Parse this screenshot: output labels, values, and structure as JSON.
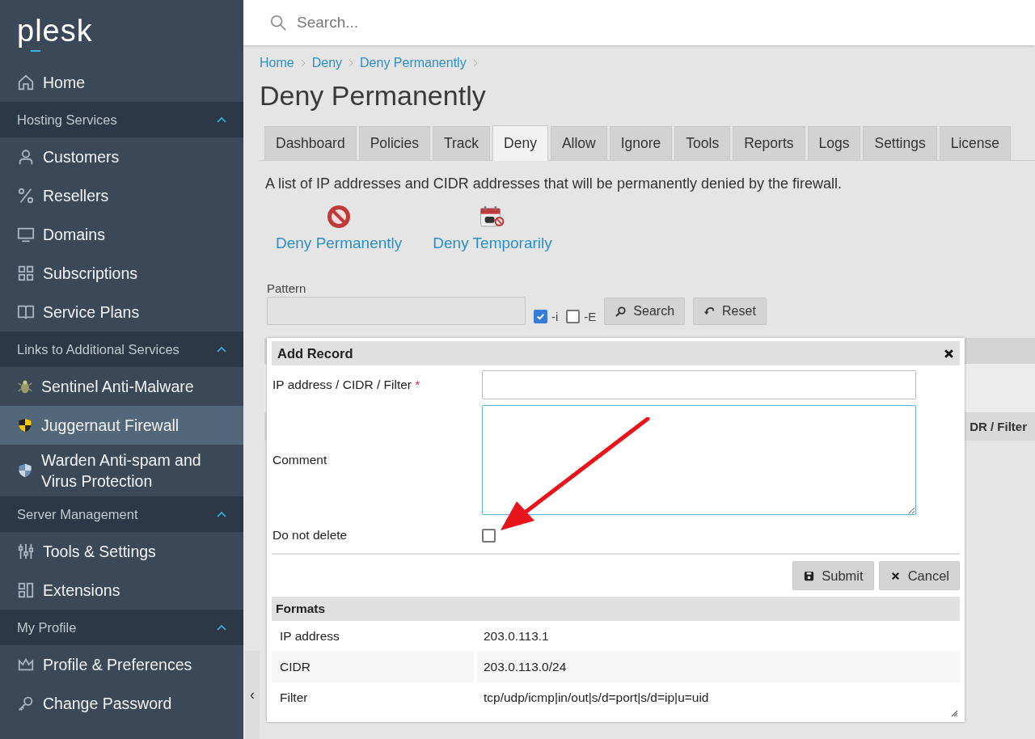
{
  "sidebar": {
    "logo": "plesk",
    "home": {
      "label": "Home",
      "selected": false
    },
    "sections": [
      {
        "title": "Hosting Services",
        "expanded": true,
        "items": [
          {
            "label": "Customers",
            "selected": false
          },
          {
            "label": "Resellers",
            "selected": false
          },
          {
            "label": "Domains",
            "selected": false
          },
          {
            "label": "Subscriptions",
            "selected": false
          },
          {
            "label": "Service Plans",
            "selected": false
          }
        ]
      },
      {
        "title": "Links to Additional Services",
        "expanded": true,
        "items": [
          {
            "label": "Sentinel Anti-Malware",
            "selected": false
          },
          {
            "label": "Juggernaut Firewall",
            "selected": true
          },
          {
            "label": "Warden Anti-spam and Virus Protection",
            "selected": false
          }
        ]
      },
      {
        "title": "Server Management",
        "expanded": true,
        "items": [
          {
            "label": "Tools & Settings",
            "selected": false
          },
          {
            "label": "Extensions",
            "selected": false
          }
        ]
      },
      {
        "title": "My Profile",
        "expanded": true,
        "items": [
          {
            "label": "Profile & Preferences",
            "selected": false
          },
          {
            "label": "Change Password",
            "selected": false
          }
        ]
      }
    ],
    "collapse_handle": "‹"
  },
  "search": {
    "placeholder": "Search..."
  },
  "breadcrumbs": [
    "Home",
    "Deny",
    "Deny Permanently"
  ],
  "title": "Deny Permanently",
  "tabs": [
    {
      "label": "Dashboard",
      "selected": false
    },
    {
      "label": "Policies",
      "selected": false
    },
    {
      "label": "Track",
      "selected": false
    },
    {
      "label": "Deny",
      "selected": true
    },
    {
      "label": "Allow",
      "selected": false
    },
    {
      "label": "Ignore",
      "selected": false
    },
    {
      "label": "Tools",
      "selected": false
    },
    {
      "label": "Reports",
      "selected": false
    },
    {
      "label": "Logs",
      "selected": false
    },
    {
      "label": "Settings",
      "selected": false
    },
    {
      "label": "License",
      "selected": false
    }
  ],
  "description": "A list of IP addresses and CIDR addresses that will be permanently denied by the firewall.",
  "actions": [
    {
      "label": "Deny Permanently"
    },
    {
      "label": "Deny Temporarily"
    }
  ],
  "filter": {
    "label": "Pattern",
    "options": [
      {
        "label": "-i",
        "checked": true
      },
      {
        "label": "-E",
        "checked": false
      }
    ],
    "buttons": [
      "Search",
      "Reset"
    ]
  },
  "table": {
    "column_heading": "DR / Filter"
  },
  "dialog": {
    "title": "Add Record",
    "fields": [
      {
        "kind": "text",
        "label": "IP address / CIDR / Filter",
        "required_mark": "*"
      },
      {
        "kind": "textarea",
        "label": "Comment",
        "focused": true
      },
      {
        "kind": "checkbox",
        "label": "Do not delete",
        "checked": false
      }
    ],
    "buttons": [
      "Submit",
      "Cancel"
    ],
    "formats": {
      "title": "Formats",
      "rows": [
        {
          "name": "IP address",
          "example": "203.0.113.1"
        },
        {
          "name": "CIDR",
          "example": "203.0.113.0/24"
        },
        {
          "name": "Filter",
          "example": "tcp/udp/icmp|in/out|s/d=port|s/d=ip|u=uid"
        }
      ]
    }
  }
}
